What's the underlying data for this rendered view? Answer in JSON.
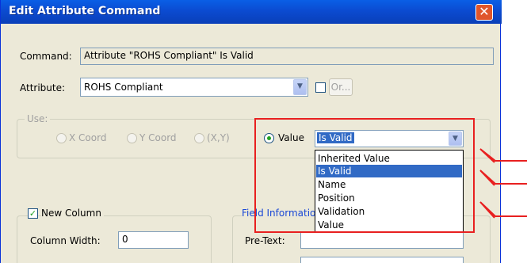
{
  "window": {
    "title": "Edit Attribute Command",
    "close_label": "✕"
  },
  "command": {
    "label": "Command:",
    "value": "Attribute \"ROHS Compliant\" Is Valid"
  },
  "attribute": {
    "label": "Attribute:",
    "value": "ROHS Compliant",
    "or_label": "Or..."
  },
  "use": {
    "label": "Use:",
    "x_coord": "X Coord",
    "y_coord": "Y Coord",
    "xy": "(X,Y)",
    "value_label": "Value",
    "value_select": "Is Valid",
    "options": [
      "Inherited Value",
      "Is Valid",
      "Name",
      "Position",
      "Validation",
      "Value"
    ],
    "selected_option": "Is Valid"
  },
  "new_column": {
    "label": "New Column",
    "width_label": "Column Width:",
    "width_value": "0"
  },
  "field_info": {
    "label": "Field Informatio",
    "pre_text_label": "Pre-Text:"
  },
  "colors": {
    "selection": "#316ac5",
    "annotation": "#e82020",
    "titlebar": "#0a5fe6"
  }
}
